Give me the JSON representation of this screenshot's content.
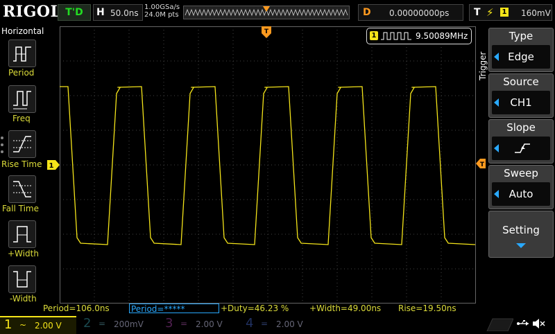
{
  "header": {
    "brand": "RIGOL",
    "run_state": "T'D",
    "timebase_label": "H",
    "timebase_value": "50.0ns",
    "sample_rate": "1.00GSa/s",
    "memory_depth": "24.0M pts",
    "delay_label": "D",
    "delay_value": "0.00000000ps",
    "trigger_label": "T",
    "trigger_channel": "1",
    "trigger_level": "160mV"
  },
  "left_menu": {
    "title": "Horizontal",
    "items": [
      {
        "label": "Period",
        "icon": "period-icon"
      },
      {
        "label": "Freq",
        "icon": "freq-icon"
      },
      {
        "label": "Rise Time",
        "icon": "rise-time-icon"
      },
      {
        "label": "Fall Time",
        "icon": "fall-time-icon"
      },
      {
        "label": "+Width",
        "icon": "positive-width-icon"
      },
      {
        "label": "-Width",
        "icon": "negative-width-icon"
      }
    ]
  },
  "freq_counter": {
    "channel": "1",
    "value": "9.50089MHz"
  },
  "right_menu": {
    "title": "Trigger",
    "type": {
      "title": "Type",
      "value": "Edge"
    },
    "source": {
      "title": "Source",
      "value": "CH1"
    },
    "slope": {
      "title": "Slope",
      "icon": "rising-edge-icon"
    },
    "sweep": {
      "title": "Sweep",
      "value": "Auto"
    },
    "setting": {
      "title": "Setting"
    }
  },
  "measurements": [
    "Period=106.0ns",
    "Period=*****",
    "+Duty=46.23 %",
    "+Width=49.00ns",
    "Rise=19.50ns"
  ],
  "channels": [
    {
      "num": "1",
      "coupling": "~",
      "scale": "2.00 V",
      "color": "#f5e51a",
      "active": true
    },
    {
      "num": "2",
      "coupling": "=",
      "scale": "200mV",
      "color": "#22ccee",
      "active": false
    },
    {
      "num": "3",
      "coupling": "=",
      "scale": "2.00 V",
      "color": "#ee22cc",
      "active": false
    },
    {
      "num": "4",
      "coupling": "=",
      "scale": "2.00 V",
      "color": "#2266ff",
      "active": false
    }
  ],
  "colors": {
    "ch1": "#f5e51a",
    "accent": "#29a9ff",
    "trigger": "#ff9a1f"
  },
  "waveform": {
    "type": "square",
    "amplitude_divisions": 4.6,
    "period_divisions": 2.12,
    "duty_percent": 46.23
  }
}
